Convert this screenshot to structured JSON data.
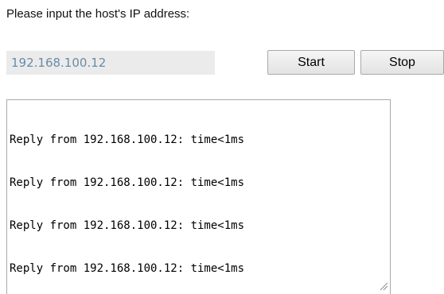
{
  "prompt": {
    "text": "Please input the host's IP address:"
  },
  "ip_field": {
    "value": "192.168.100.12"
  },
  "buttons": {
    "start_label": "Start",
    "stop_label": "Stop"
  },
  "output": {
    "lines": [
      "Reply from 192.168.100.12: time<1ms",
      "Reply from 192.168.100.12: time<1ms",
      "Reply from 192.168.100.12: time<1ms",
      "Reply from 192.168.100.12: time<1ms"
    ]
  },
  "icons": {
    "resize": "resize-grip-icon"
  },
  "colors": {
    "input_background": "#ebebeb",
    "input_text": "#6b8ba6",
    "border": "#a9a9a9"
  }
}
